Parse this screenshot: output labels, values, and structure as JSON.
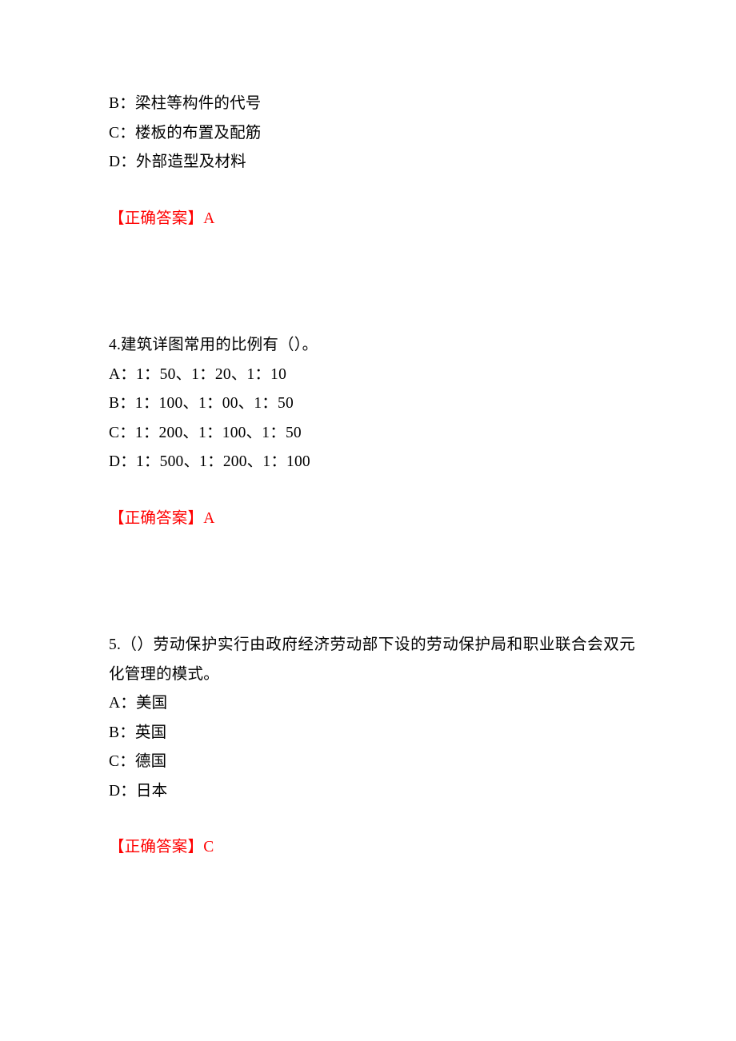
{
  "document": {
    "type": "exam-question-sheet",
    "language": "zh-CN",
    "answer_color": "#ff0000",
    "text_color": "#000000",
    "background_color": "#ffffff"
  },
  "questions": [
    {
      "id": "q3-partial",
      "number": "",
      "stem": "",
      "options": [
        "B：梁柱等构件的代号",
        "C：楼板的布置及配筋",
        "D：外部造型及材料"
      ],
      "answer_label": "【正确答案】",
      "answer_value": "A"
    },
    {
      "id": "q4",
      "number": "4.",
      "stem": "4.建筑详图常用的比例有（）。",
      "options": [
        "A：1：50、1：20、1：10",
        "B：1：100、1：00、1：50",
        "C：1：200、1：100、1：50",
        "D：1：500、1：200、1：100"
      ],
      "answer_label": "【正确答案】",
      "answer_value": "A"
    },
    {
      "id": "q5",
      "number": "5.",
      "stem": "5.（）劳动保护实行由政府经济劳动部下设的劳动保护局和职业联合会双元化管理的模式。",
      "options": [
        "A：美国",
        "B：英国",
        "C：德国",
        "D：日本"
      ],
      "answer_label": "【正确答案】",
      "answer_value": "C"
    }
  ]
}
